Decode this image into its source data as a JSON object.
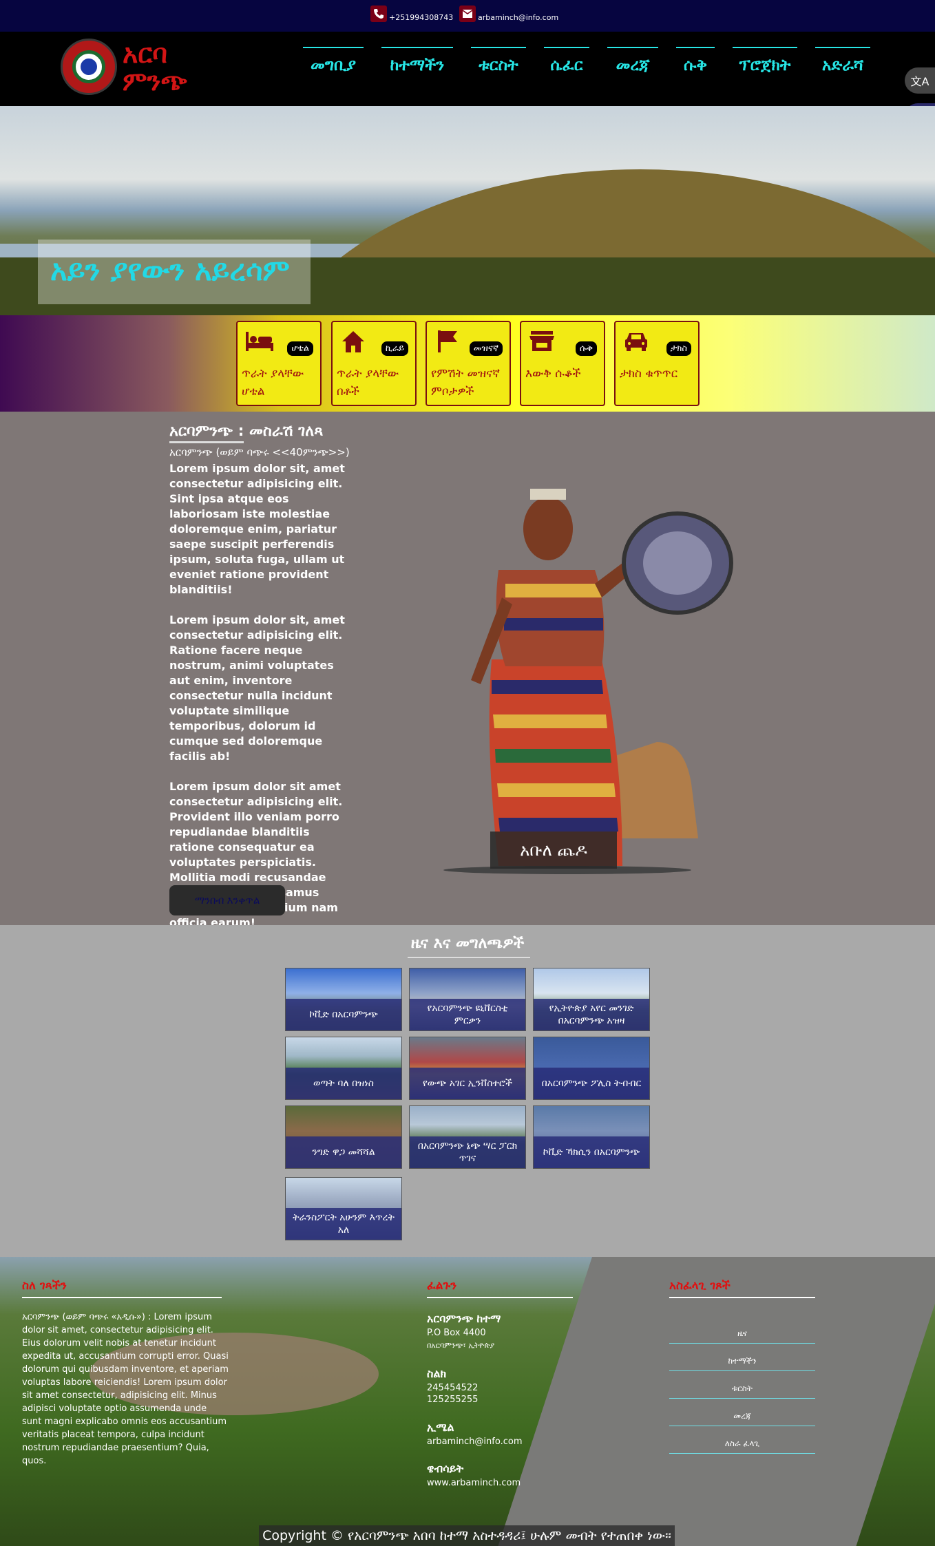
{
  "topbar": {
    "phone": "+251994308743",
    "email": "arbaminch@info.com"
  },
  "logo": {
    "line1": "አርባ",
    "line2": "ምንጭ"
  },
  "nav": [
    "መግቢያ",
    "ከተማችን",
    "ቱርስት",
    "ሴፈር",
    "መረጃ",
    "ሱቅ",
    "ፕሮጀክት",
    "አድራሻ"
  ],
  "side_buttons": {
    "translate": "文A",
    "chat": "•‿•"
  },
  "hero": {
    "title": "አይን ያየውን አይረሳም"
  },
  "categories": [
    {
      "tag": "ሆቴል",
      "label": "ጥራት ያላቸው ሆቴል",
      "icon": "bed-icon"
    },
    {
      "tag": "ኪራይ",
      "label": "ጥራት ያላቸው በቶች",
      "icon": "house-icon"
    },
    {
      "tag": "መዝናኛ",
      "label": "የምሽት መዝናኛ ምቦታዎች",
      "icon": "flag-icon"
    },
    {
      "tag": "ሱቅ",
      "label": "እውቅ ሱቆች",
      "icon": "store-icon"
    },
    {
      "tag": "ታክስ",
      "label": "ታክስ ቁጥጥር",
      "icon": "car-icon"
    }
  ],
  "about": {
    "title": "አርባምንጭ : መስራሽ ገለጻ",
    "subtitle": "አርባምንጭ (ወይም ባጭሩ <<40ምንጭ>>)",
    "paragraphs": [
      "Lorem ipsum dolor sit, amet consectetur adipisicing elit. Sint ipsa atque eos laboriosam iste molestiae doloremque enim, pariatur saepe suscipit perferendis ipsum, soluta fuga, ullam ut eveniet ratione provident blanditiis!",
      "Lorem ipsum dolor sit, amet consectetur adipisicing elit. Ratione facere neque nostrum, animi voluptates aut enim, inventore consectetur nulla incidunt voluptate similique temporibus, dolorum id cumque sed doloremque facilis ab!",
      "Lorem ipsum dolor sit amet consectetur adipisicing elit. Provident illo veniam porro repudiandae blanditiis ratione consequatur ea voluptates perspiciatis. Mollitia modi recusandae sunt dolores accusamus deserunt praesentium nam officia earum!"
    ],
    "button": "ማንበብ እንቀጥል",
    "statue_caption": "አቡለ ጨዶ"
  },
  "news": {
    "title": "ዜና እና መግለጫዎች",
    "items": [
      "ኮቪድ በአርባምንጭ",
      "የአርባምንጭ ዩኒቨርስቲ ምርቃን",
      "የኢትዮጵያ አየር መንገድ በአርባምንጭ አዝዛ",
      "ወጣት ባለ በዝነስ",
      "የውጭ አገር ኢንቨስተሮች",
      "በአርባምንጭ ፖሊስ ትብብር",
      "ንግድ ዋጋ መሻሻል",
      "በአርባምንጭ ኔጭ ሣር ፓርክ ጥገና",
      "ኮቪድ ኻክሲን በአርባምንጭ",
      "ትራንስፖርት አሁንም እጥረት አለ"
    ]
  },
  "footer": {
    "about_title": "ስለ ገጻችን",
    "about_text": "አርባምንጭ (ወይም ባጭሩ «አዲሱ») : Lorem ipsum dolor sit amet, consectetur adipisicing elit. Eius dolorum velit nobis at tenetur incidunt expedita ut, accusantium corrupti error. Quasi dolorum qui quibusdam inventore, et aperiam voluptas labore reiciendis! Lorem ipsum dolor sit amet consectetur, adipisicing elit. Minus adipisci voluptate optio assumenda unde sunt magni explicabo omnis eos accusantium veritatis placeat tempora, culpa incidunt nostrum repudiandae praesentium? Quia, quos.",
    "contact_title": "ፈልጉን",
    "contact_org": "አርባምንጭ ከተማ",
    "contact_box": "P.O Box 4400",
    "contact_city": "በአርባምንጭ፣ ኢትዮጵያ",
    "phone_label": "ስልክ",
    "phone1": "245454522",
    "phone2": "125255255",
    "email_label": "ኢሜል",
    "email": "arbaminch@info.com",
    "web_label": "ዌብሳይት",
    "web": "www.arbaminch.com",
    "links_title": "አስፈላጊ ገጾች",
    "links": [
      "ዜና",
      "ከተማችን",
      "ቱርስት",
      "መረጃ",
      "ለስራ ፈላጊ"
    ],
    "copyright": "Copyright © የአርባምንጭ አበባ ከተማ አስተዳዳሪ፤ ሁሉም መብት የተጠበቀ ነው፡፡"
  }
}
